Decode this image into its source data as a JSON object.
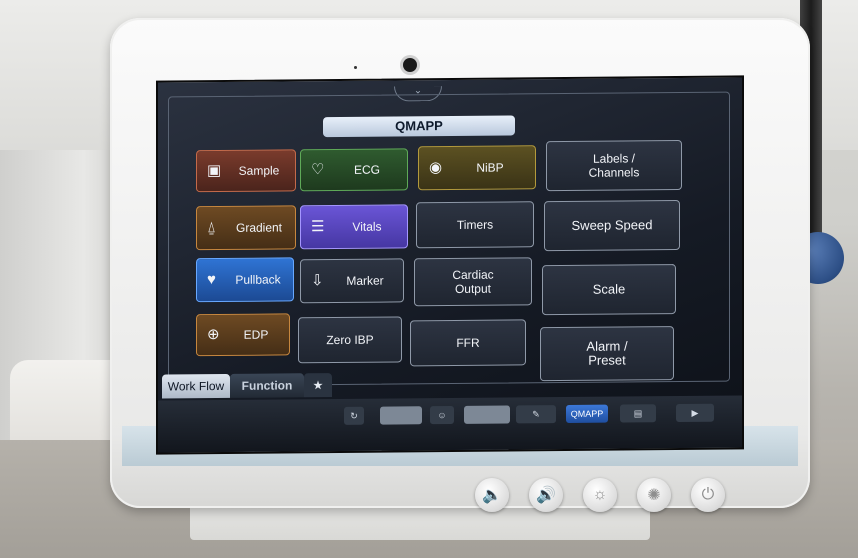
{
  "screen": {
    "title": "QMAPP",
    "tiles": [
      {
        "key": "sample",
        "label": "Sample",
        "icon": "sample-icon"
      },
      {
        "key": "ecg",
        "label": "ECG",
        "icon": "heart-monitor-icon"
      },
      {
        "key": "nibp",
        "label": "NiBP",
        "icon": "bp-cuff-icon"
      },
      {
        "key": "labels",
        "label": "Labels /\nChannels"
      },
      {
        "key": "gradient",
        "label": "Gradient",
        "icon": "gradient-icon"
      },
      {
        "key": "vitals",
        "label": "Vitals",
        "icon": "document-icon"
      },
      {
        "key": "timers",
        "label": "Timers"
      },
      {
        "key": "sweep",
        "label": "Sweep Speed"
      },
      {
        "key": "pullback",
        "label": "Pullback",
        "icon": "heart-icon"
      },
      {
        "key": "marker",
        "label": "Marker",
        "icon": "marker-icon"
      },
      {
        "key": "cardiac",
        "label": "Cardiac\nOutput"
      },
      {
        "key": "scale",
        "label": "Scale"
      },
      {
        "key": "edp",
        "label": "EDP",
        "icon": "edp-icon"
      },
      {
        "key": "zeroibp",
        "label": "Zero IBP"
      },
      {
        "key": "ffr",
        "label": "FFR"
      },
      {
        "key": "alarm",
        "label": "Alarm /\nPreset"
      }
    ],
    "tabs": {
      "workflow": "Work Flow",
      "function": "Function",
      "star": "★"
    },
    "toolstrip": {
      "qmapp": "QMAPP"
    }
  }
}
